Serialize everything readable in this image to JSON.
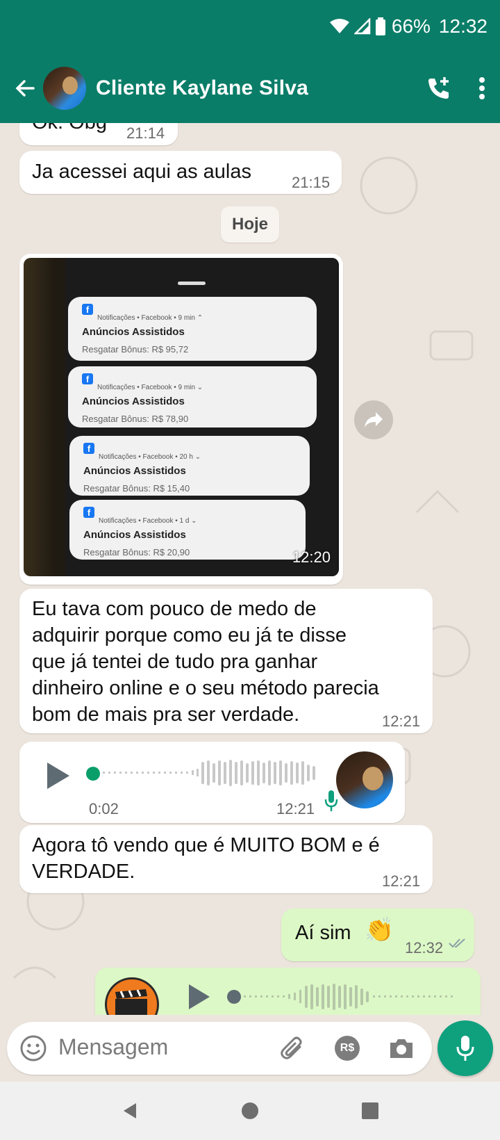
{
  "status_bar": {
    "battery": "66%",
    "time": "12:32"
  },
  "header": {
    "contact_name": "Cliente Kaylane Silva"
  },
  "messages": {
    "m1": {
      "text": "Ok. Obg",
      "time": "21:14"
    },
    "m2": {
      "text": "Ja acessei aqui as aulas",
      "time": "21:15"
    },
    "day_chip": "Hoje",
    "image": {
      "time": "12:20",
      "notifications": [
        {
          "source": "Notificações • Facebook • 9 min ⌃",
          "title": "Anúncios Assistidos",
          "body": "Resgatar Bônus: R$ 95,72"
        },
        {
          "source": "Notificações • Facebook • 9 min ⌄",
          "title": "Anúncios Assistidos",
          "body": "Resgatar Bônus: R$ 78,90"
        },
        {
          "source": "Notificações • Facebook • 20 h ⌄",
          "title": "Anúncios Assistidos",
          "body": "Resgatar Bônus: R$ 15,40"
        },
        {
          "source": "Notificações • Facebook • 1 d ⌄",
          "title": "Anúncios Assistidos",
          "body": "Resgatar Bônus: R$ 20,90"
        }
      ]
    },
    "m3": {
      "lines": [
        "Eu tava com pouco de medo de",
        "adquirir porque como eu já te disse",
        "que já tentei de tudo pra ganhar",
        "dinheiro online e o seu método parecia",
        "bom de mais pra ser verdade."
      ],
      "time": "12:21"
    },
    "voice_in": {
      "duration": "0:02",
      "time": "12:21"
    },
    "m4": {
      "lines": [
        "Agora tô vendo que é MUITO BOM e é",
        "VERDADE."
      ],
      "time": "12:21"
    },
    "m5": {
      "text": "Aí sim",
      "emoji": "👏",
      "time": "12:32",
      "status": "read"
    }
  },
  "input": {
    "placeholder": "Mensagem",
    "pay_label": "R$"
  },
  "colors": {
    "header": "#0a7d68",
    "outgoing": "#dcf8c6",
    "accent": "#0fa07e"
  }
}
